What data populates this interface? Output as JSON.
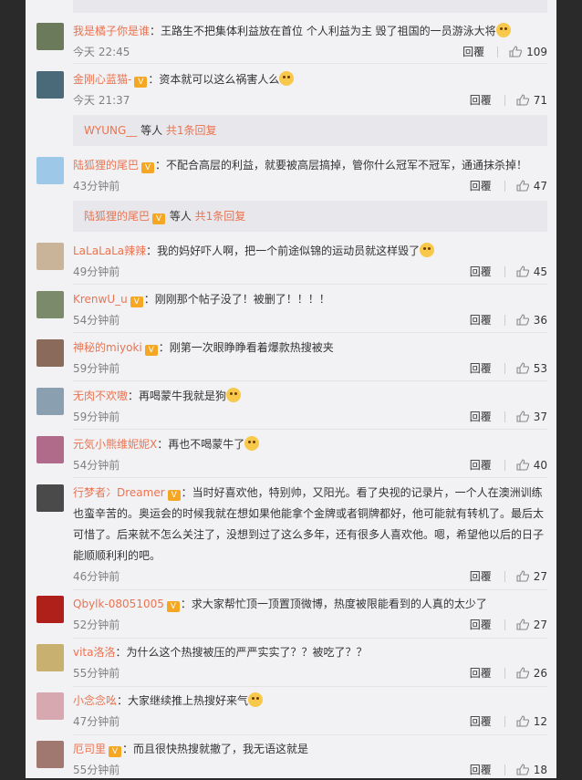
{
  "labels": {
    "reply": "回覆",
    "others_suffix": " 等人 ",
    "v_badge": "V"
  },
  "comments": [
    {
      "user": "我是橘子你是谁",
      "badge": false,
      "text": "：王路生不把集体利益放在首位 个人利益为主 毁了祖国的一员游泳大将",
      "emoji": true,
      "time": "今天 22:45",
      "likes": "109",
      "avatar_color": "#6b7a5a"
    },
    {
      "user": "金刚心蓝猫-",
      "badge": true,
      "text": "：资本就可以这么祸害人么",
      "emoji": true,
      "time": "今天 21:37",
      "likes": "71",
      "avatar_color": "#4a6a7a"
    },
    {
      "user": "陆狐狸的尾巴",
      "badge": true,
      "text": "：不配合高层的利益，就要被高层搞掉，管你什么冠军不冠军，通通抹杀掉！",
      "emoji": false,
      "time": "43分钟前",
      "likes": "47",
      "avatar_color": "#9ec8e8"
    },
    {
      "user": "LaLaLaLa辣辣",
      "badge": false,
      "text": "：我的妈好吓人啊，把一个前途似锦的运动员就这样毁了",
      "emoji": true,
      "time": "49分钟前",
      "likes": "45",
      "avatar_color": "#c9b49a"
    },
    {
      "user": "KrenwU_u",
      "badge": true,
      "text": "：刚刚那个帖子没了！被删了！！！！",
      "emoji": false,
      "time": "54分钟前",
      "likes": "36",
      "avatar_color": "#7a8a6a"
    },
    {
      "user": "神秘的miyoki",
      "badge": true,
      "text": "：刚第一次眼睁睁看着爆款热搜被夹",
      "emoji": false,
      "time": "59分钟前",
      "likes": "53",
      "avatar_color": "#8a6a5a"
    },
    {
      "user": "无肉不欢嗷",
      "badge": false,
      "text": "：再喝蒙牛我就是狗",
      "emoji": true,
      "time": "59分钟前",
      "likes": "37",
      "avatar_color": "#8aa0b0"
    },
    {
      "user": "元気小熊维妮妮X",
      "badge": false,
      "text": "：再也不喝蒙牛了",
      "emoji": true,
      "time": "54分钟前",
      "likes": "40",
      "avatar_color": "#b06a8a"
    },
    {
      "user": "行梦者冫Dreamer",
      "badge": true,
      "text": "：当时好喜欢他，特别帅，又阳光。看了央视的记录片，一个人在澳洲训练也蛮辛苦的。奥运会的时候我就在想如果他能拿个金牌或者铜牌都好，他可能就有转机了。最后太可惜了。后来就不怎么关注了，没想到过了这么多年，还有很多人喜欢他。嗯，希望他以后的日子能顺顺利利的吧。",
      "emoji": false,
      "time": "46分钟前",
      "likes": "27",
      "avatar_color": "#4a4a4a"
    },
    {
      "user": "Qbylk-08051005",
      "badge": true,
      "text": "：求大家帮忙顶一顶置顶微博，热度被限能看到的人真的太少了",
      "emoji": false,
      "time": "52分钟前",
      "likes": "27",
      "avatar_color": "#b0201a"
    },
    {
      "user": "vita洛洛",
      "badge": false,
      "text": "：为什么这个热搜被压的严严实实了？？被吃了？？",
      "emoji": false,
      "time": "55分钟前",
      "likes": "26",
      "avatar_color": "#c8b070"
    },
    {
      "user": "小念念吆",
      "badge": false,
      "text": "：大家继续推上热搜好来气",
      "emoji": true,
      "time": "47分钟前",
      "likes": "12",
      "avatar_color": "#d8a8b0"
    },
    {
      "user": "厄司里",
      "badge": true,
      "text": "：而且很快热搜就撤了，我无语这就是",
      "emoji": false,
      "time": "55分钟前",
      "likes": "18",
      "avatar_color": "#a07870"
    }
  ],
  "sub_replies": [
    {
      "user": "WYUNG__",
      "badge": false,
      "count": "共1条回复"
    },
    {
      "user": "陆狐狸的尾巴",
      "badge": true,
      "count": "共1条回复"
    }
  ]
}
